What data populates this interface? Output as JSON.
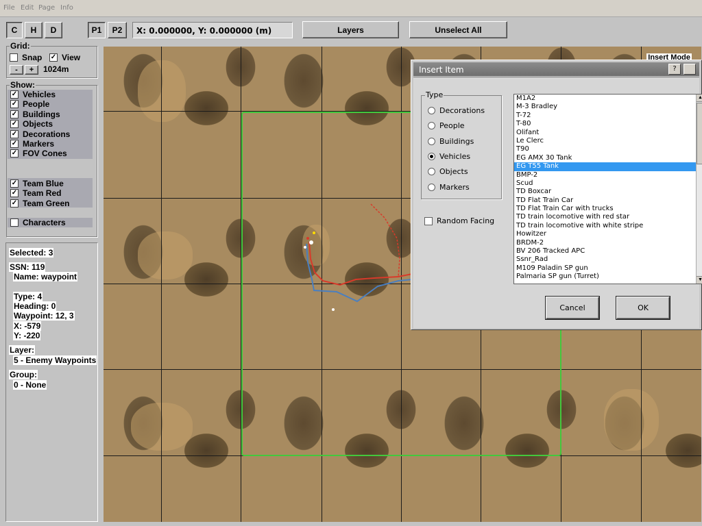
{
  "menu": [
    "File",
    "Edit",
    "Page",
    "Info"
  ],
  "toolbar": {
    "view_buttons": [
      "C",
      "H",
      "D"
    ],
    "page_buttons": [
      "P1",
      "P2"
    ],
    "coords": "X: 0.000000, Y: 0.000000 (m)",
    "layers_label": "Layers",
    "unselect_label": "Unselect All"
  },
  "grid": {
    "title": "Grid:",
    "snap_label": "Snap",
    "snap_checked": false,
    "view_label": "View",
    "view_checked": true,
    "minus_label": "-",
    "plus_label": "+",
    "size": "1024m"
  },
  "show": {
    "title": "Show:",
    "items": [
      {
        "label": "Vehicles",
        "checked": true
      },
      {
        "label": "People",
        "checked": true
      },
      {
        "label": "Buildings",
        "checked": true
      },
      {
        "label": "Objects",
        "checked": true
      },
      {
        "label": "Decorations",
        "checked": true
      },
      {
        "label": "Markers",
        "checked": true
      },
      {
        "label": "FOV Cones",
        "checked": true
      }
    ],
    "teams": [
      {
        "label": "Team Blue",
        "checked": true
      },
      {
        "label": "Team Red",
        "checked": true
      },
      {
        "label": "Team Green",
        "checked": true
      }
    ],
    "characters": {
      "label": "Characters",
      "checked": false
    }
  },
  "selection": {
    "selected": "Selected: 3",
    "ssn": "SSN: 119",
    "name": "Name: waypoint",
    "type": "Type: 4",
    "heading": "Heading: 0",
    "waypoint": "Waypoint: 12, 3",
    "x": "X: -579",
    "y": "Y: -220",
    "layer_title": "Layer:",
    "layer_value": "5 - Enemy Waypoints",
    "group_title": "Group:",
    "group_value": "0 - None"
  },
  "map": {
    "mode_label": "Insert Mode"
  },
  "dialog": {
    "title": "Insert Item",
    "type_title": "Type",
    "types": [
      {
        "label": "Decorations",
        "selected": false
      },
      {
        "label": "People",
        "selected": false
      },
      {
        "label": "Buildings",
        "selected": false
      },
      {
        "label": "Vehicles",
        "selected": true
      },
      {
        "label": "Objects",
        "selected": false
      },
      {
        "label": "Markers",
        "selected": false
      }
    ],
    "random_facing_label": "Random Facing",
    "random_facing_checked": false,
    "items": [
      "M1A2",
      "M-3 Bradley",
      "T-72",
      "T-80",
      "Olifant",
      "Le Clerc",
      "T90",
      "EG AMX 30 Tank",
      "EG T55 Tank",
      "BMP-2",
      "Scud",
      "TD Boxcar",
      "TD Flat Train Car",
      "TD Flat Train Car with trucks",
      "TD train locomotive with red star",
      "TD train locomotive with white stripe",
      "Howitzer",
      "BRDM-2",
      "BV 206 Tracked APC",
      "Ssnr_Rad",
      "M109 Paladin SP gun",
      "Palmaria SP gun (Turret)"
    ],
    "selected_item": "EG T55 Tank",
    "cancel_label": "Cancel",
    "ok_label": "OK"
  },
  "colors": {
    "selection_blue": "#3398f0",
    "area_green": "#43c83c",
    "path_red": "#d83a2a",
    "path_blue": "#4a7fc0"
  }
}
